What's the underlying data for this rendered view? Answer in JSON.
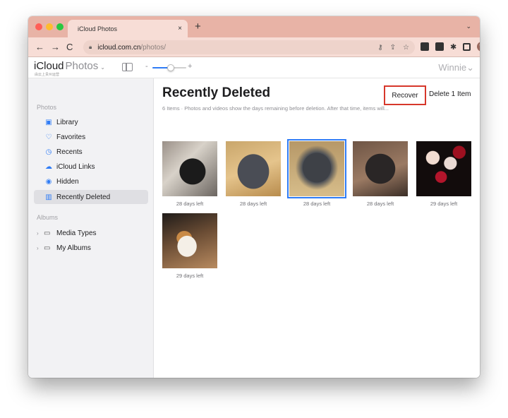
{
  "browser": {
    "tab_title": "iCloud Photos",
    "tab_close": "×",
    "new_tab": "+",
    "tab_menu": "⌄",
    "url_host": "icloud.com.cn",
    "url_path": "/photos/",
    "avatar_letter": "W",
    "nav_back": "←",
    "nav_forward": "→",
    "nav_reload": "C"
  },
  "app": {
    "brand": "iCloud",
    "brand_product": "Photos",
    "brand_sub": "由云上贵州运营",
    "zoom_minus": "-",
    "zoom_plus": "+",
    "zoom_level": 0.55,
    "user_name": "Winnie",
    "user_chevron": "⌄"
  },
  "sidebar": {
    "photos_header": "Photos",
    "items": [
      {
        "label": "Library",
        "icon": "library-icon"
      },
      {
        "label": "Favorites",
        "icon": "heart-icon"
      },
      {
        "label": "Recents",
        "icon": "clock-icon"
      },
      {
        "label": "iCloud Links",
        "icon": "cloud-link-icon"
      },
      {
        "label": "Hidden",
        "icon": "eye-icon"
      },
      {
        "label": "Recently Deleted",
        "icon": "trash-icon",
        "active": true
      }
    ],
    "albums_header": "Albums",
    "albums": [
      {
        "label": "Media Types",
        "icon": "folder-icon"
      },
      {
        "label": "My Albums",
        "icon": "folder-icon"
      }
    ]
  },
  "main": {
    "title": "Recently Deleted",
    "recover_label": "Recover",
    "delete_label": "Delete 1 Item",
    "subtitle": "6 Items · Photos and videos show the days remaining before deletion. After that time, items will...",
    "photos": [
      {
        "caption": "28 days left",
        "selected": false
      },
      {
        "caption": "28 days left",
        "selected": false
      },
      {
        "caption": "28 days left",
        "selected": true
      },
      {
        "caption": "28 days left",
        "selected": false
      },
      {
        "caption": "29 days left",
        "selected": false
      },
      {
        "caption": "29 days left",
        "selected": false
      }
    ]
  },
  "colors": {
    "accent": "#2f7cf6",
    "highlight_box": "#d7372b",
    "tab_bar": "#e8b3a6"
  }
}
